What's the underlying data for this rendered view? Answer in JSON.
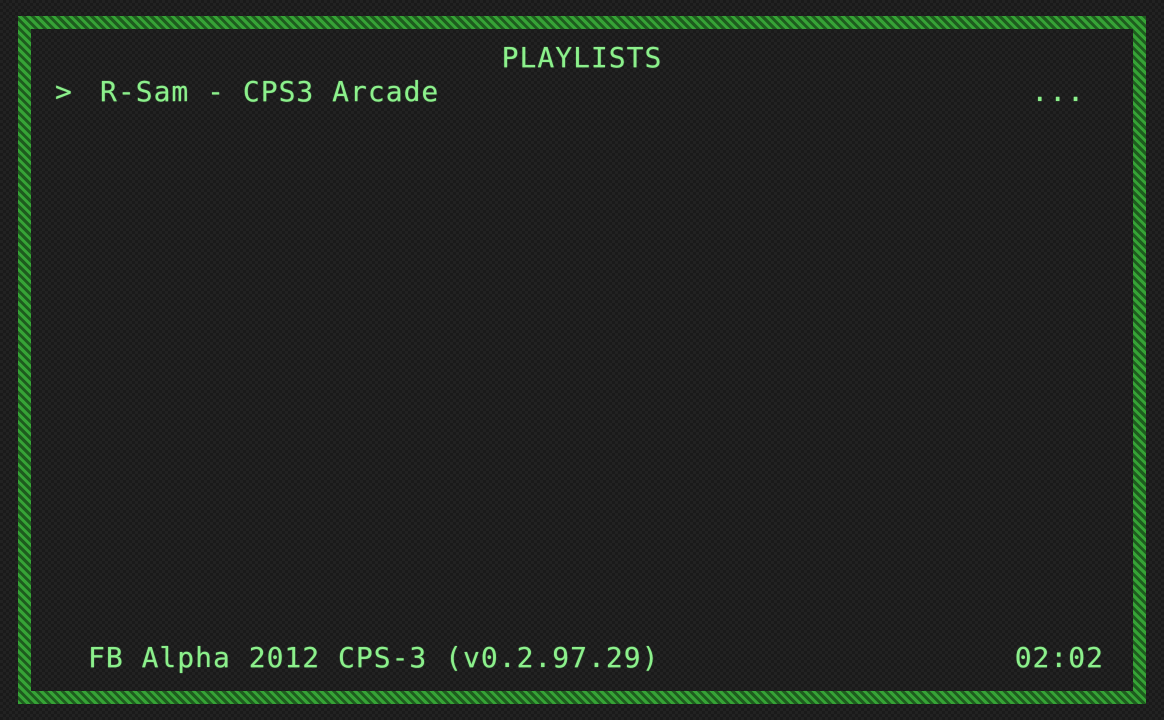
{
  "menu": {
    "title": "PLAYLISTS",
    "cursor": ">",
    "items": [
      {
        "label": "R-Sam - CPS3 Arcade",
        "value": "..."
      }
    ]
  },
  "footer": {
    "core_info": "FB Alpha 2012 CPS-3 (v0.2.97.29)",
    "clock": "02:02"
  },
  "colors": {
    "text": "#8cf08c",
    "frame": "#2f8a2f",
    "background": "#222222"
  }
}
